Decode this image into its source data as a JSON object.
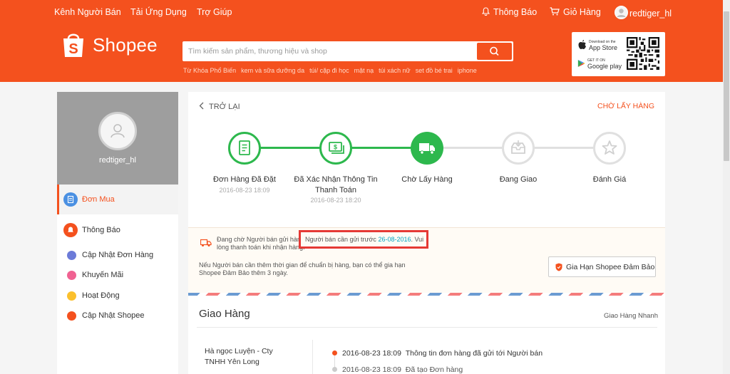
{
  "topnav": {
    "seller_channel": "Kênh Người Bán",
    "download_app": "Tải Ứng Dụng",
    "help": "Trợ Giúp",
    "notifications": "Thông Báo",
    "cart": "Giỏ Hàng",
    "username": "redtiger_hl"
  },
  "brand": {
    "name": "Shopee",
    "color": "#f4511e"
  },
  "search": {
    "placeholder": "Tìm kiếm sản phẩm, thương hiệu và shop",
    "keywords_label": "Từ Khóa Phổ Biến",
    "keywords": [
      "kem và sữa dưỡng da",
      "túi/ cặp đi học",
      "mặt nạ",
      "túi xách nữ",
      "set đồ bé trai",
      "iphone"
    ]
  },
  "apps": {
    "app_store_small": "Download on the",
    "app_store": "App Store",
    "google_play_small": "GET IT ON",
    "google_play": "Google play"
  },
  "sidebar": {
    "username": "redtiger_hl",
    "items": [
      {
        "label": "Đơn Mua",
        "icon": "clipboard-icon",
        "color": "#4a90e2",
        "active": true
      },
      {
        "label": "Thông Báo",
        "icon": "bell-icon",
        "color": "#f4511e"
      },
      {
        "label": "Cập Nhật Đơn Hàng",
        "icon": "document-icon",
        "color": "#6c7bd8"
      },
      {
        "label": "Khuyến Mãi",
        "icon": "tag-icon",
        "color": "#f06292"
      },
      {
        "label": "Hoạt Động",
        "icon": "lightning-icon",
        "color": "#fbc02d"
      },
      {
        "label": "Cập Nhật Shopee",
        "icon": "shopee-bag-icon",
        "color": "#f4511e"
      }
    ]
  },
  "order": {
    "back": "TRỞ LẠI",
    "status": "CHỜ LẤY HÀNG",
    "steps": [
      {
        "label": "Đơn Hàng Đã Đặt",
        "date": "2016-08-23 18:09",
        "state": "done",
        "icon": "receipt-icon"
      },
      {
        "label": "Đã Xác Nhận Thông Tin Thanh Toán",
        "date": "2016-08-23 18:20",
        "state": "done",
        "icon": "money-icon"
      },
      {
        "label": "Chờ Lấy Hàng",
        "date": "",
        "state": "current",
        "icon": "truck-icon"
      },
      {
        "label": "Đang Giao",
        "date": "",
        "state": "pending",
        "icon": "inbox-icon"
      },
      {
        "label": "Đánh Giá",
        "date": "",
        "state": "pending",
        "icon": "star-icon"
      }
    ],
    "notice": {
      "line1": "Đang chờ Người bán gửi hàng.",
      "line2": "lòng thanh toán khi nhận hàng.",
      "highlight_prefix": "Người bán cần gửi trước",
      "highlight_date": "26-08-2016",
      "highlight_suffix": ". Vui",
      "extension_line1": "Nếu Người bán cần thêm thời gian để chuẩn bị hàng, bạn có thể gia hạn",
      "extension_line2": "Shopee Đảm Bảo thêm 3 ngày.",
      "extend_button": "Gia Hạn Shopee Đảm Bảo"
    }
  },
  "shipping": {
    "title": "Giao Hàng",
    "method": "Giao Hàng Nhanh",
    "address_line1": "Hà ngọc Luyện - Cty",
    "address_line2": "TNHH Yên Long",
    "timeline": [
      {
        "time": "2016-08-23 18:09",
        "text": "Thông tin đơn hàng đã gửi tới Người bán"
      },
      {
        "time": "2016-08-23 18:09",
        "text": "Đã tạo Đơn hàng"
      }
    ]
  }
}
